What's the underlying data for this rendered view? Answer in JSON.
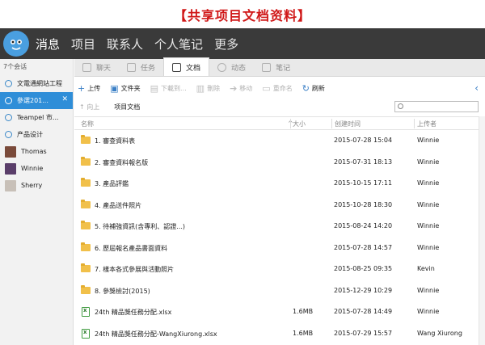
{
  "banner": "【共享项目文档资料】",
  "nav": [
    "消息",
    "项目",
    "联系人",
    "个人笔记",
    "更多"
  ],
  "sidebar": {
    "header": "7个会话",
    "items": [
      {
        "label": "文電通網站工程",
        "type": "chat"
      },
      {
        "label": "參選201...",
        "type": "chat",
        "selected": true
      },
      {
        "label": "Teampel 市...",
        "type": "chat"
      },
      {
        "label": "产品设计",
        "type": "chat"
      },
      {
        "label": "Thomas",
        "type": "user",
        "avatar_color": "#7a4a3a"
      },
      {
        "label": "Winnie",
        "type": "user",
        "avatar_color": "#5a3e6a"
      },
      {
        "label": "Sherry",
        "type": "user",
        "avatar_color": "#c8c0b8"
      }
    ]
  },
  "tabs": [
    "聊天",
    "任务",
    "文档",
    "动态",
    "笔记"
  ],
  "active_tab": "文档",
  "toolbar": {
    "upload": "上传",
    "folder": "文件夹",
    "download": "下載到...",
    "delete": "刪除",
    "move": "移动",
    "rename": "重命名",
    "refresh": "刷新"
  },
  "path": {
    "back": "向上",
    "crumb": "项目文档"
  },
  "columns": {
    "name": "名称",
    "size": "大小",
    "created": "创建时间",
    "uploader": "上传者"
  },
  "files": [
    {
      "type": "folder",
      "name": "1. 審查資料表",
      "size": "",
      "created": "2015-07-28 15:04",
      "uploader": "Winnie"
    },
    {
      "type": "folder",
      "name": "2. 審查資料報名版",
      "size": "",
      "created": "2015-07-31 18:13",
      "uploader": "Winnie"
    },
    {
      "type": "folder",
      "name": "3. 產品評鑑",
      "size": "",
      "created": "2015-10-15 17:11",
      "uploader": "Winnie"
    },
    {
      "type": "folder",
      "name": "4. 產品送件照片",
      "size": "",
      "created": "2015-10-28 18:30",
      "uploader": "Winnie"
    },
    {
      "type": "folder",
      "name": "5. 待補強資訊(含專利、認證...)",
      "size": "",
      "created": "2015-08-24 14:20",
      "uploader": "Winnie"
    },
    {
      "type": "folder",
      "name": "6. 歷屆報名產品書面資料",
      "size": "",
      "created": "2015-07-28 14:57",
      "uploader": "Winnie"
    },
    {
      "type": "folder",
      "name": "7. 樣本各式參展與活動照片",
      "size": "",
      "created": "2015-08-25 09:35",
      "uploader": "Kevin"
    },
    {
      "type": "folder",
      "name": "8. 參獎檢討(2015)",
      "size": "",
      "created": "2015-12-29 10:29",
      "uploader": "Winnie"
    },
    {
      "type": "xlsx",
      "name": "24th 精品獎任務分配.xlsx",
      "size": "1.6MB",
      "created": "2015-07-28 14:49",
      "uploader": "Winnie"
    },
    {
      "type": "xlsx",
      "name": "24th 精品獎任務分配-WangXiurong.xlsx",
      "size": "1.6MB",
      "created": "2015-07-29 15:57",
      "uploader": "Wang Xiurong"
    }
  ]
}
